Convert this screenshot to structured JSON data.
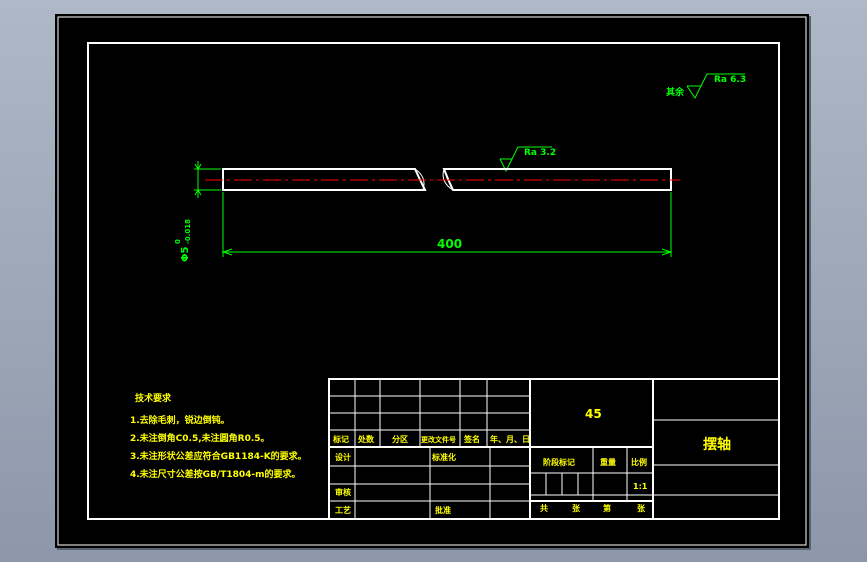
{
  "drawing": {
    "roughness_default": {
      "prefix": "其余",
      "value": "Ra 6.3"
    },
    "roughness_surface": {
      "value": "Ra 3.2"
    },
    "dimension_length": "400",
    "dimension_diameter": "Φ5",
    "tolerance_upper": "0",
    "tolerance_lower": "-0.018"
  },
  "notes": {
    "title": "技术要求",
    "items": [
      "1.去除毛刺，锐边倒钝。",
      "2.未注倒角C0.5,未注圆角R0.5。",
      "3.未注形状公差应符合GB1184-K的要求。",
      "4.未注尺寸公差按GB/T1804-m的要求。"
    ]
  },
  "title_block": {
    "material": "45",
    "part_name": "摆轴",
    "change_headers": [
      "标记",
      "处数",
      "分区",
      "更改文件号",
      "签名",
      "年、月、日"
    ],
    "design": "设计",
    "standardize": "标准化",
    "review": "审核",
    "process": "工艺",
    "approve": "批准",
    "stage_mark": "阶段标记",
    "weight": "重量",
    "scale_label": "比例",
    "scale_value": "1:1",
    "sheet_total": "共",
    "sheet_zhang": "张",
    "sheet_di": "第",
    "sheet_zhang2": "张"
  },
  "colors": {
    "background": "#000000",
    "frame": "#ffffff",
    "annotation": "#00ff00",
    "centerline": "#ff0000",
    "text_yellow": "#ffff00"
  }
}
